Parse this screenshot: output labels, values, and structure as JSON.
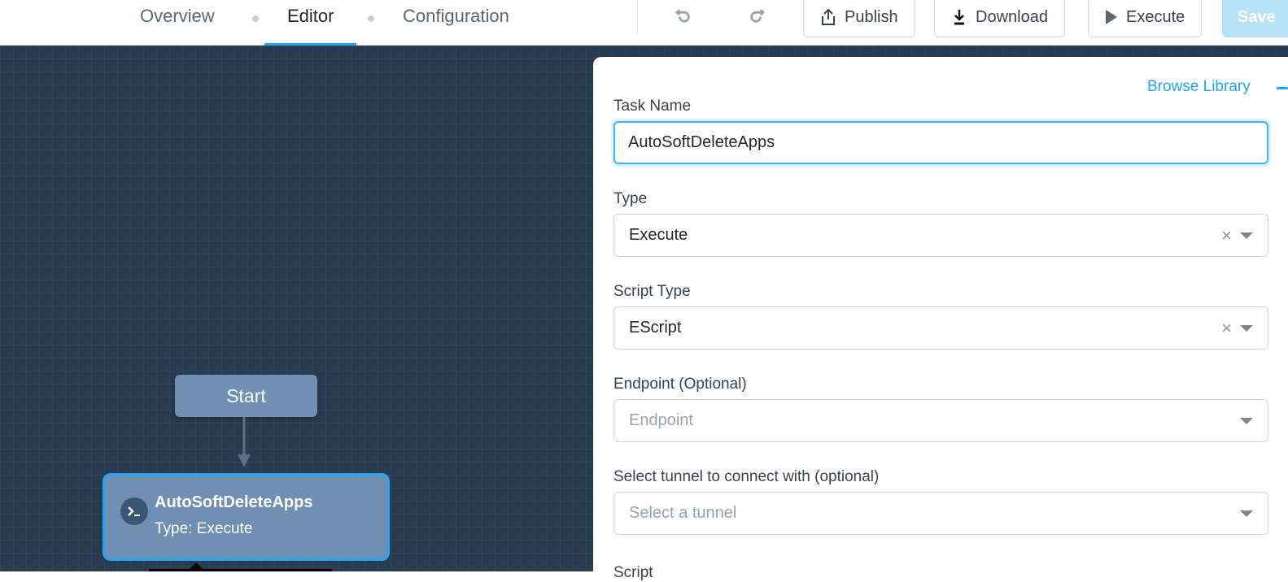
{
  "header": {
    "tabs": [
      {
        "label": "Overview",
        "active": false
      },
      {
        "label": "Editor",
        "active": true
      },
      {
        "label": "Configuration",
        "active": false
      }
    ],
    "toolbar": {
      "undo_icon": "undo-icon",
      "redo_icon": "redo-icon",
      "publish_label": "Publish",
      "download_label": "Download",
      "execute_label": "Execute",
      "save_label": "Save"
    },
    "accent_color": "#22a5f7"
  },
  "canvas": {
    "start_node": {
      "label": "Start"
    },
    "task_node": {
      "icon": "terminal-icon",
      "title": "AutoSoftDeleteApps",
      "subtitle": "Type: Execute"
    }
  },
  "panel": {
    "browse_library_label": "Browse Library",
    "fields": {
      "task_name": {
        "label": "Task Name",
        "value": "AutoSoftDeleteApps"
      },
      "type": {
        "label": "Type",
        "value": "Execute"
      },
      "script_type": {
        "label": "Script Type",
        "value": "EScript"
      },
      "endpoint": {
        "label": "Endpoint (Optional)",
        "placeholder": "Endpoint"
      },
      "tunnel": {
        "label": "Select tunnel to connect with (optional)",
        "placeholder": "Select a tunnel"
      },
      "script": {
        "label": "Script"
      }
    }
  }
}
